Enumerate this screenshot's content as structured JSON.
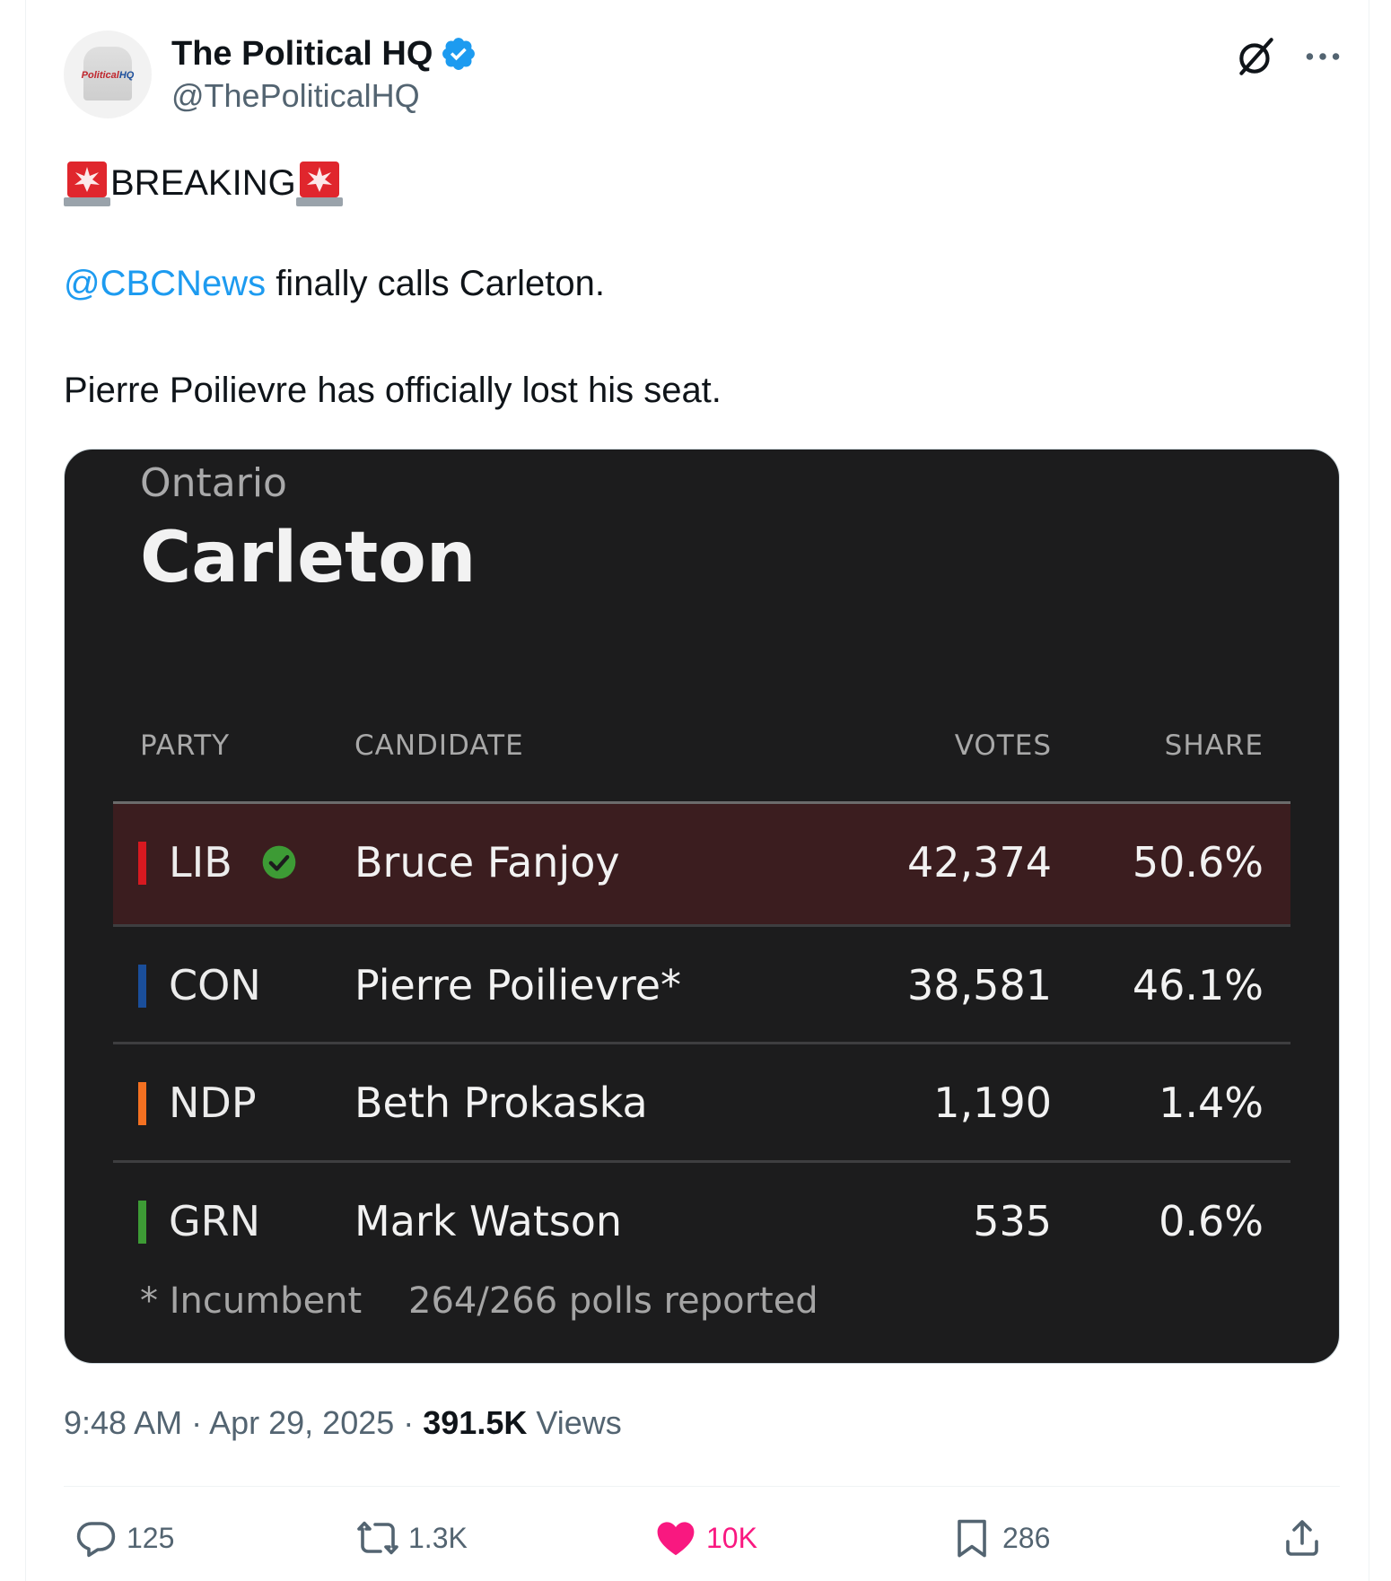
{
  "author": {
    "display_name": "The Political HQ",
    "handle": "@ThePoliticalHQ",
    "avatar_text_red": "Political",
    "avatar_text_blue": "HQ",
    "verified": true
  },
  "tweet": {
    "breaking_label": "BREAKING",
    "mention": "@CBCNews",
    "line1_rest": " finally calls Carleton.",
    "line2": "Pierre Poilievre has officially lost his seat."
  },
  "results_card": {
    "province": "Ontario",
    "riding": "Carleton",
    "headers": {
      "party": "PARTY",
      "candidate": "CANDIDATE",
      "votes": "VOTES",
      "share": "SHARE"
    },
    "rows": [
      {
        "party": "LIB",
        "color": "#d71920",
        "candidate": "Bruce Fanjoy",
        "votes": "42,374",
        "share": "50.6%",
        "winner": true
      },
      {
        "party": "CON",
        "color": "#1a4e9a",
        "candidate": "Pierre Poilievre*",
        "votes": "38,581",
        "share": "46.1%",
        "winner": false
      },
      {
        "party": "NDP",
        "color": "#f37021",
        "candidate": "Beth Prokaska",
        "votes": "1,190",
        "share": "1.4%",
        "winner": false
      },
      {
        "party": "GRN",
        "color": "#3d9b35",
        "candidate": "Mark Watson",
        "votes": "535",
        "share": "0.6%",
        "winner": false
      }
    ],
    "footnote_incumbent": "* Incumbent",
    "footnote_polls": "264/266 polls reported"
  },
  "meta": {
    "time": "9:48 AM",
    "separator": " · ",
    "date": "Apr 29, 2025",
    "views_count": "391.5K",
    "views_label": "Views"
  },
  "actions": {
    "replies": "125",
    "reposts": "1.3K",
    "likes": "10K",
    "bookmarks": "286"
  },
  "colors": {
    "accent": "#1d9bf0",
    "like": "#f91880",
    "winner_row": "#3b1d1f",
    "check": "#3d9b35"
  }
}
